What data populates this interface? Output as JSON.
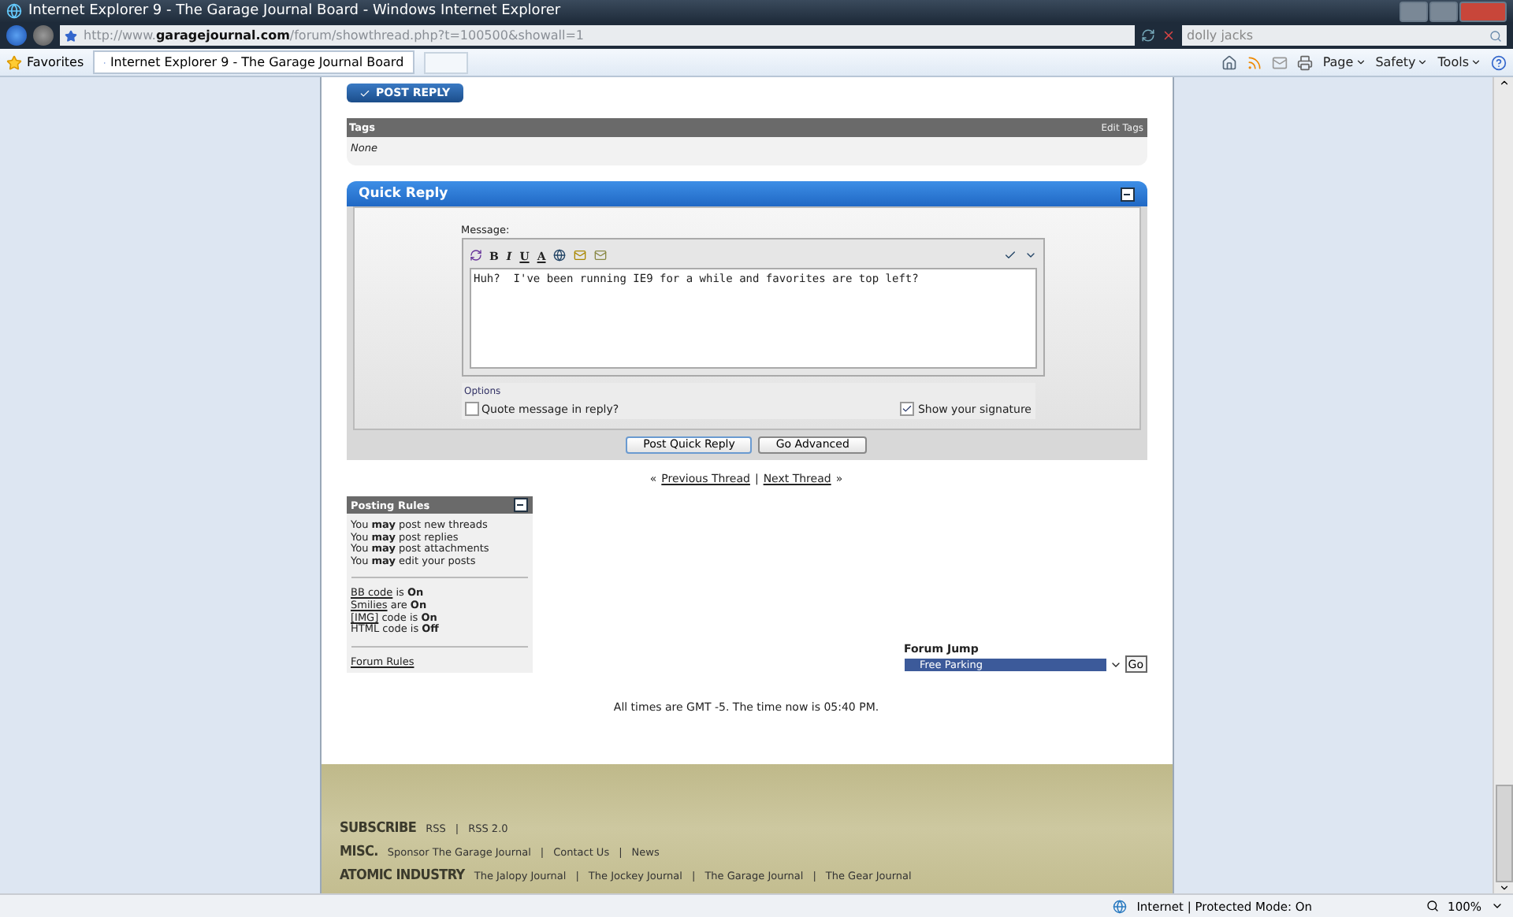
{
  "window": {
    "title": "Internet Explorer 9 - The Garage Journal Board - Windows Internet Explorer"
  },
  "address_bar": {
    "url": "http://www.**garagejournal.com**/forum/showthread.php?t=100500&showall=1"
  },
  "search": {
    "value": "dolly jacks"
  },
  "favorites_bar": {
    "favorites": "Favorites",
    "tab": "Internet Explorer 9 - The Garage Journal Board"
  },
  "command_bar": [
    "Page",
    "Safety",
    "Tools"
  ],
  "page": {
    "post_reply": "POST REPLY",
    "tags": {
      "title": "Tags",
      "action": "Edit Tags",
      "value": "None"
    },
    "quick_reply": {
      "title": "Quick Reply",
      "message_label": "Message:",
      "format_buttons": [
        "B",
        "I",
        "U",
        "A"
      ],
      "message": "Huh?  I've been running IE9 for a while and favorites are top left?",
      "options_label": "Options",
      "options": [
        {
          "label": "Quote message in reply?",
          "checked": false
        },
        {
          "label": "Show your signature",
          "checked": true
        }
      ],
      "buttons": [
        "Post Quick Reply",
        "Go Advanced"
      ]
    },
    "thread_nav": {
      "before": "«",
      "previous": "Previous Thread",
      "separator": "|",
      "next": "Next Thread",
      "after": "»"
    },
    "posting_rules": {
      "title": "Posting Rules",
      "permissions": [
        "You **may** post new threads",
        "You **may** post replies",
        "You **may** post attachments",
        "You **may** edit your posts"
      ],
      "settings": [
        {
          "link": "BB code",
          "text": "is **On**"
        },
        {
          "link": "Smilies",
          "text": "are **On**"
        },
        {
          "link": "[IMG]",
          "text": "code is **On**"
        },
        {
          "text": "HTML code is **Off**"
        }
      ],
      "rules_link": "Forum Rules"
    },
    "forum_jump": {
      "label": "Forum Jump",
      "selected": "Free Parking",
      "go": "Go"
    },
    "time_note": "All times are GMT -5. The time now is 05:40 PM.",
    "footer": [
      {
        "heading": "SUBSCRIBE",
        "links": [
          {
            "label": "RSS"
          },
          {
            "separator": "|",
            "label": "RSS 2.0"
          }
        ]
      },
      {
        "heading": "MISC.",
        "links": [
          {
            "label": "Sponsor The Garage Journal"
          },
          {
            "separator": "|",
            "label": "Contact Us"
          },
          {
            "separator": "|",
            "label": "News"
          }
        ]
      },
      {
        "heading": "ATOMIC INDUSTRY",
        "links": [
          {
            "label": "The Jalopy Journal"
          },
          {
            "separator": "|",
            "label": "The Jockey Journal"
          },
          {
            "separator": "|",
            "label": "The Garage Journal"
          },
          {
            "separator": "|",
            "label": "The Gear Journal"
          }
        ]
      }
    ]
  },
  "status_bar": {
    "zone": "Internet | Protected Mode: On",
    "zoom": "100%"
  }
}
